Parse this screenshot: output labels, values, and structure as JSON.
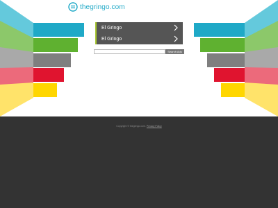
{
  "site": {
    "domain": "thegringo.com",
    "accent_color": "#1fa9c7"
  },
  "links": [
    {
      "label": "El Gringo",
      "icon": "chevron-right-icon"
    },
    {
      "label": "El Gringo",
      "icon": "chevron-right-icon"
    }
  ],
  "search": {
    "value": "",
    "placeholder": "",
    "button_label": "Search Ads"
  },
  "footer": {
    "copyright": "Copyright © thegringo.com.",
    "privacy_label": "Privacy Policy"
  },
  "fan_colors": [
    "#1fa9c7",
    "#5fb130",
    "#7f7f7f",
    "#e0142f",
    "#ffd600"
  ]
}
